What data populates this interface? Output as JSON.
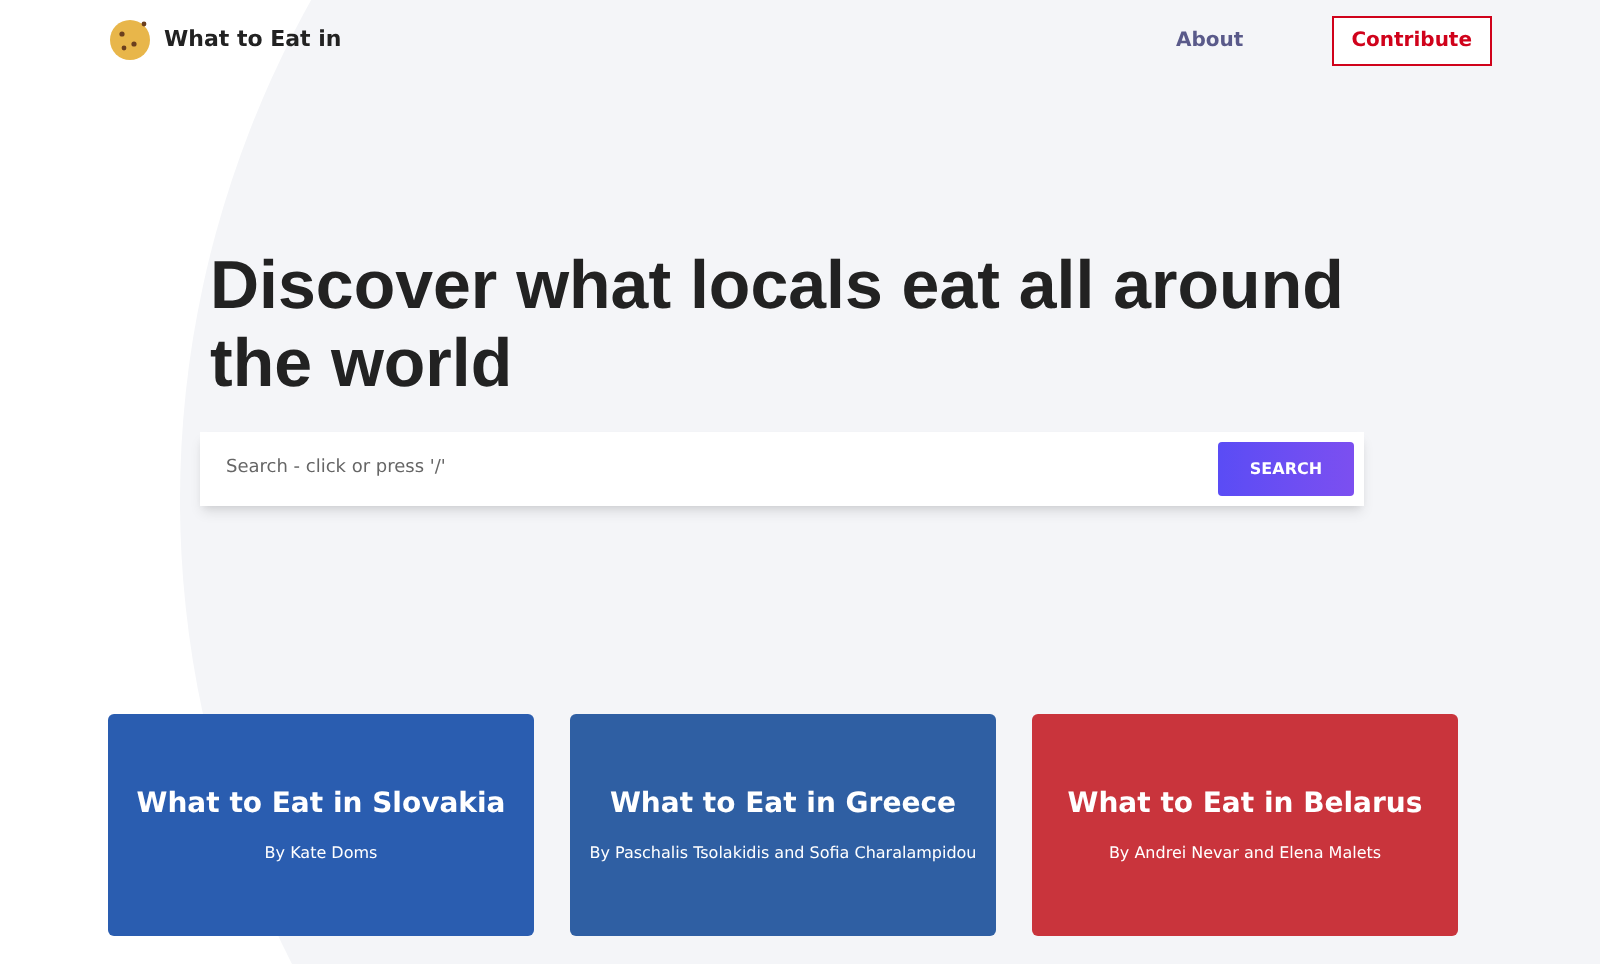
{
  "header": {
    "brand": "What to Eat in",
    "nav": [
      {
        "label": "About",
        "kind": "link"
      },
      {
        "label": "Contribute",
        "kind": "button"
      }
    ]
  },
  "hero": {
    "title": "Discover what locals eat all around the world"
  },
  "search": {
    "placeholder": "Search - click or press '/'",
    "button": "SEARCH"
  },
  "cards": [
    {
      "title": "What to Eat in Slovakia",
      "author": "By Kate Doms",
      "color": "#2a5db0"
    },
    {
      "title": "What to Eat in Greece",
      "author": "By Paschalis Tsolakidis and Sofia Charalampidou",
      "color": "#2f5fa3"
    },
    {
      "title": "What to Eat in Belarus",
      "author": "By Andrei Nevar and Elena Malets",
      "color": "#c9343c"
    }
  ]
}
